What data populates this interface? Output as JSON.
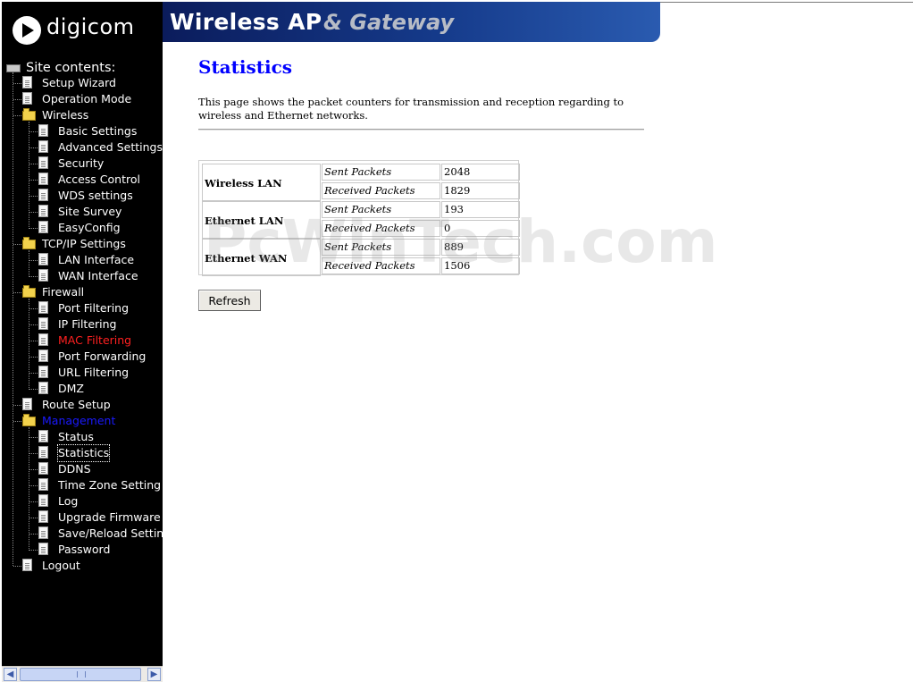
{
  "header": {
    "logo_text": "digicom",
    "banner_title": "Wireless AP",
    "banner_subtitle": "& Gateway"
  },
  "sidebar": {
    "root": "Site contents:",
    "items": [
      {
        "label": "Setup Wizard",
        "level": 1,
        "icon": "page-icon"
      },
      {
        "label": "Operation Mode",
        "level": 1,
        "icon": "page-icon"
      },
      {
        "label": "Wireless",
        "level": 1,
        "icon": "folder-icon"
      },
      {
        "label": "Basic Settings",
        "level": 2,
        "icon": "page-icon"
      },
      {
        "label": "Advanced Settings",
        "level": 2,
        "icon": "page-icon"
      },
      {
        "label": "Security",
        "level": 2,
        "icon": "page-icon"
      },
      {
        "label": "Access Control",
        "level": 2,
        "icon": "page-icon"
      },
      {
        "label": "WDS settings",
        "level": 2,
        "icon": "page-icon"
      },
      {
        "label": "Site Survey",
        "level": 2,
        "icon": "page-icon"
      },
      {
        "label": "EasyConfig",
        "level": 2,
        "icon": "page-icon"
      },
      {
        "label": "TCP/IP Settings",
        "level": 1,
        "icon": "folder-icon"
      },
      {
        "label": "LAN Interface",
        "level": 2,
        "icon": "page-icon"
      },
      {
        "label": "WAN Interface",
        "level": 2,
        "icon": "page-icon"
      },
      {
        "label": "Firewall",
        "level": 1,
        "icon": "folder-icon"
      },
      {
        "label": "Port Filtering",
        "level": 2,
        "icon": "page-icon"
      },
      {
        "label": "IP Filtering",
        "level": 2,
        "icon": "page-icon"
      },
      {
        "label": "MAC Filtering",
        "level": 2,
        "icon": "page-icon",
        "color": "#ff2020"
      },
      {
        "label": "Port Forwarding",
        "level": 2,
        "icon": "page-icon"
      },
      {
        "label": "URL Filtering",
        "level": 2,
        "icon": "page-icon"
      },
      {
        "label": "DMZ",
        "level": 2,
        "icon": "page-icon"
      },
      {
        "label": "Route Setup",
        "level": 1,
        "icon": "page-icon"
      },
      {
        "label": "Management",
        "level": 1,
        "icon": "folder-icon",
        "color": "#1a1aff"
      },
      {
        "label": "Status",
        "level": 2,
        "icon": "page-icon"
      },
      {
        "label": "Statistics",
        "level": 2,
        "icon": "page-icon",
        "selected": true
      },
      {
        "label": "DDNS",
        "level": 2,
        "icon": "page-icon"
      },
      {
        "label": "Time Zone Setting",
        "level": 2,
        "icon": "page-icon"
      },
      {
        "label": "Log",
        "level": 2,
        "icon": "page-icon"
      },
      {
        "label": "Upgrade Firmware",
        "level": 2,
        "icon": "page-icon"
      },
      {
        "label": "Save/Reload Settings",
        "level": 2,
        "icon": "page-icon"
      },
      {
        "label": "Password",
        "level": 2,
        "icon": "page-icon"
      },
      {
        "label": "Logout",
        "level": 1,
        "icon": "page-icon"
      }
    ]
  },
  "main": {
    "title": "Statistics",
    "description": "This page shows the packet counters for transmission and reception regarding to wireless and Ethernet networks.",
    "groups": [
      {
        "name": "Wireless LAN",
        "rows": [
          {
            "label": "Sent Packets",
            "value": "2048"
          },
          {
            "label": "Received Packets",
            "value": "1829"
          }
        ]
      },
      {
        "name": "Ethernet LAN",
        "rows": [
          {
            "label": "Sent Packets",
            "value": "193"
          },
          {
            "label": "Received Packets",
            "value": "0"
          }
        ]
      },
      {
        "name": "Ethernet WAN",
        "rows": [
          {
            "label": "Sent Packets",
            "value": "889"
          },
          {
            "label": "Received Packets",
            "value": "1506"
          }
        ]
      }
    ],
    "refresh_label": "Refresh",
    "watermark": "PcWinTech.com"
  }
}
